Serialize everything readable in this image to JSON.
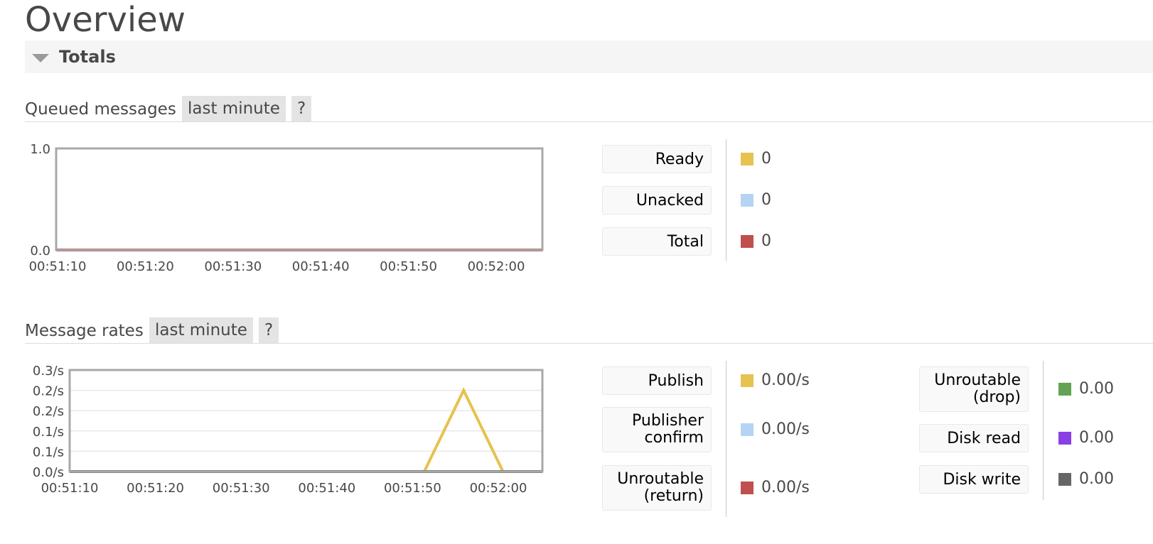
{
  "page": {
    "title": "Overview"
  },
  "totals_section": {
    "title": "Totals"
  },
  "queued": {
    "label": "Queued messages",
    "range_button": "last minute",
    "help_button": "?",
    "chart_data": {
      "type": "line",
      "x": [
        "00:51:10",
        "00:51:20",
        "00:51:30",
        "00:51:40",
        "00:51:50",
        "00:52:00"
      ],
      "y_ticks": [
        "1.0",
        "0.0"
      ],
      "ylim": [
        0,
        1.0
      ],
      "series": [
        {
          "name": "Ready",
          "values": [
            0,
            0,
            0,
            0,
            0,
            0,
            0,
            0,
            0,
            0,
            0,
            0,
            0
          ]
        },
        {
          "name": "Unacked",
          "values": [
            0,
            0,
            0,
            0,
            0,
            0,
            0,
            0,
            0,
            0,
            0,
            0,
            0
          ]
        },
        {
          "name": "Total",
          "values": [
            0,
            0,
            0,
            0,
            0,
            0,
            0,
            0,
            0,
            0,
            0,
            0,
            0
          ]
        }
      ]
    },
    "legend": [
      {
        "label": "Ready",
        "value": "0",
        "color": "#e6c250"
      },
      {
        "label": "Unacked",
        "value": "0",
        "color": "#b5d4f4"
      },
      {
        "label": "Total",
        "value": "0",
        "color": "#c0504d"
      }
    ]
  },
  "rates": {
    "label": "Message rates",
    "range_button": "last minute",
    "help_button": "?",
    "chart_data": {
      "type": "line",
      "x": [
        "00:51:10",
        "00:51:20",
        "00:51:30",
        "00:51:40",
        "00:51:50",
        "00:52:00"
      ],
      "y_ticks": [
        "0.3/s",
        "0.2/s",
        "0.2/s",
        "0.1/s",
        "0.1/s",
        "0.0/s"
      ],
      "ylim": [
        0,
        0.25
      ],
      "series": [
        {
          "name": "Publish",
          "values": [
            0,
            0,
            0,
            0,
            0,
            0,
            0,
            0,
            0,
            0,
            0.2,
            0,
            0
          ]
        },
        {
          "name": "Disk write",
          "values": [
            0,
            0,
            0,
            0,
            0,
            0,
            0,
            0,
            0,
            0,
            0,
            0,
            0
          ]
        }
      ]
    },
    "legend_left": [
      {
        "label": [
          "Publish"
        ],
        "value": "0.00/s",
        "color": "#e6c250"
      },
      {
        "label": [
          "Publisher",
          "confirm"
        ],
        "value": "0.00/s",
        "color": "#b5d4f4"
      },
      {
        "label": [
          "Unroutable",
          "(return)"
        ],
        "value": "0.00/s",
        "color": "#c0504d"
      }
    ],
    "legend_right": [
      {
        "label": [
          "Unroutable",
          "(drop)"
        ],
        "value": "0.00",
        "color": "#62a352"
      },
      {
        "label": [
          "Disk read"
        ],
        "value": "0.00",
        "color": "#8a3fe6"
      },
      {
        "label": [
          "Disk write"
        ],
        "value": "0.00",
        "color": "#666666"
      }
    ]
  }
}
